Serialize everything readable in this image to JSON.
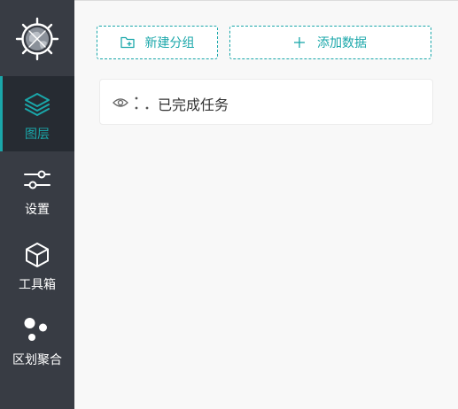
{
  "sidebar": {
    "logo_icon": "globe-compass-icon",
    "items": [
      {
        "label": "图层",
        "icon": "layers-icon",
        "active": true
      },
      {
        "label": "设置",
        "icon": "sliders-icon",
        "active": false
      },
      {
        "label": "工具箱",
        "icon": "cube-icon",
        "active": false
      },
      {
        "label": "区划聚合",
        "icon": "cluster-dots-icon",
        "active": false
      }
    ]
  },
  "toolbar": {
    "new_group_label": "新建分组",
    "new_group_icon": "folder-plus-icon",
    "add_data_label": "添加数据",
    "add_data_icon": "plus-icon"
  },
  "layers": [
    {
      "name": "已完成任务",
      "visible": true
    }
  ],
  "colors": {
    "accent": "#1aa7aa",
    "sidebar_bg": "#383c44",
    "sidebar_active_bg": "#262b32",
    "content_bg": "#f8f8f8"
  }
}
